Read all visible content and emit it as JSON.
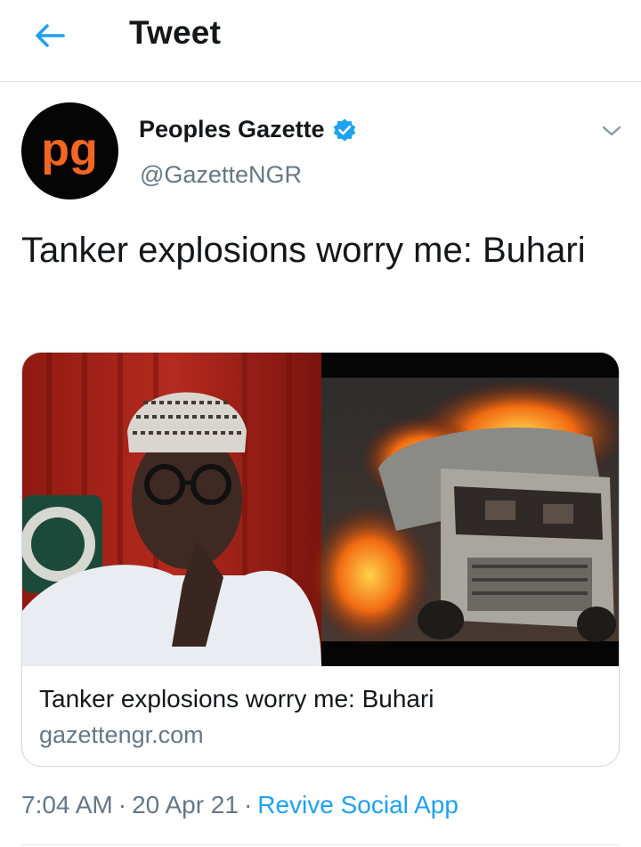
{
  "header": {
    "title": "Tweet",
    "back_icon": "arrow-left-icon"
  },
  "tweet": {
    "author": {
      "name": "Peoples Gazette",
      "handle": "@GazetteNGR",
      "verified": true,
      "avatar_text": "pg"
    },
    "text": "Tanker explosions worry me: Buhari",
    "card": {
      "title": "Tanker explosions worry me: Buhari",
      "domain": "gazettengr.com"
    },
    "time": "7:04 AM",
    "date": "20 Apr 21",
    "source": "Revive Social App"
  },
  "colors": {
    "accent": "#1da1f2",
    "secondary_text": "#657786",
    "avatar_brand": "#f26522"
  }
}
